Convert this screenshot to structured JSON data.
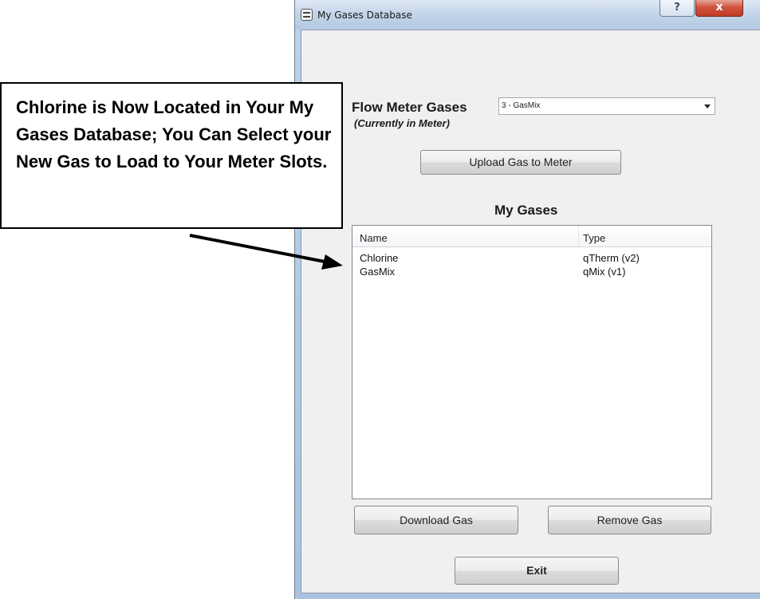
{
  "window": {
    "title": "My Gases Database",
    "help_glyph": "?",
    "close_glyph": "x",
    "icon": "app-window-icon"
  },
  "flow_meter": {
    "label": "Flow Meter Gases",
    "sublabel": "(Currently in Meter)",
    "selected_value": "3 - GasMix"
  },
  "upload_button": "Upload Gas to Meter",
  "my_gases": {
    "title": "My Gases",
    "columns": [
      "Name",
      "Type"
    ],
    "rows": [
      {
        "name": "Chlorine",
        "type": "qTherm (v2)"
      },
      {
        "name": "GasMix",
        "type": "qMix (v1)"
      }
    ]
  },
  "buttons": {
    "download": "Download Gas",
    "remove": "Remove Gas",
    "exit": "Exit"
  },
  "callout": {
    "text": "Chlorine is Now Located in Your My Gases Database; You Can Select your New Gas to Load to Your Meter Slots."
  },
  "colors": {
    "close_button": "#c13a24",
    "titlebar": "#c4d6ea",
    "client_bg": "#f0f0f0"
  }
}
